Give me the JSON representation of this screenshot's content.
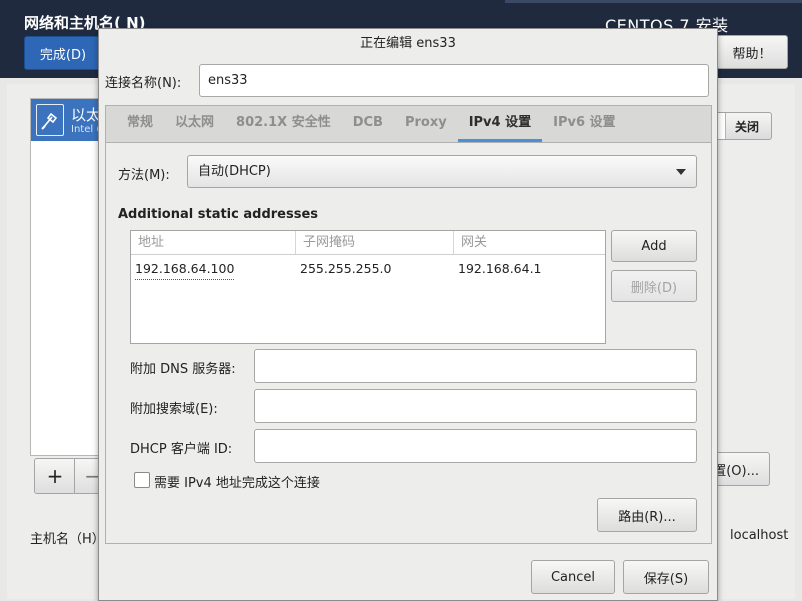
{
  "background_window": {
    "title": "网络和主机名( N)",
    "done_label": "完成(D)",
    "installer_title": "CENTOS 7 安装",
    "help_label": "帮助！",
    "device_label": "以太",
    "device_sub": "Intel (",
    "add_label": "+",
    "remove_label": "−",
    "toggle_label": "关闭",
    "configure_label": "置(O)...",
    "hostname_label": "主机名（H）",
    "current_hostname": "localhost"
  },
  "dialog": {
    "title": "正在编辑 ens33",
    "connection_name_label": "连接名称(N):",
    "connection_name_value": "ens33",
    "tabs": [
      {
        "label": "常规",
        "active": false
      },
      {
        "label": "以太网",
        "active": false
      },
      {
        "label": "802.1X 安全性",
        "active": false
      },
      {
        "label": "DCB",
        "active": false
      },
      {
        "label": "Proxy",
        "active": false
      },
      {
        "label": "IPv4 设置",
        "active": true
      },
      {
        "label": "IPv6 设置",
        "active": false
      }
    ],
    "method_label": "方法(M):",
    "method_value": "自动(DHCP)",
    "addresses_heading": "Additional static addresses",
    "addresses_table": {
      "columns": [
        "地址",
        "子网掩码",
        "网关"
      ],
      "rows": [
        {
          "address": "192.168.64.100",
          "netmask": "255.255.255.0",
          "gateway": "192.168.64.1"
        }
      ]
    },
    "add_button": "Add",
    "delete_button": "删除(D)",
    "dns_label": "附加 DNS 服务器:",
    "dns_value": "",
    "search_domains_label": "附加搜索域(E):",
    "search_domains_value": "",
    "dhcp_client_id_label": "DHCP 客户端 ID:",
    "dhcp_client_id_value": "",
    "require_ipv4_label": "需要 IPv4 地址完成这个连接",
    "require_ipv4_checked": false,
    "routes_button": "路由(R)...",
    "cancel_button": "Cancel",
    "save_button": "保存(S)"
  }
}
